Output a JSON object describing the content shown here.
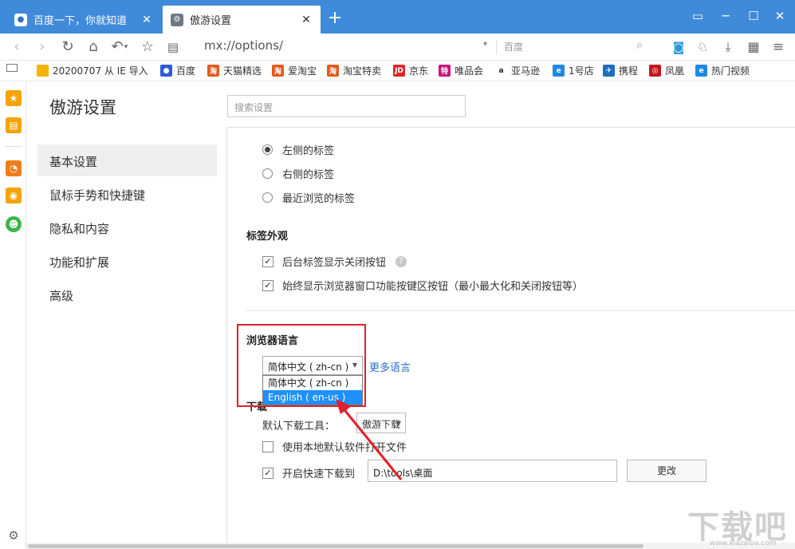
{
  "tabs": [
    {
      "label": "百度一下，你就知道",
      "icon": "baidu-paw-icon"
    },
    {
      "label": "傲游设置",
      "icon": "settings-gear-icon"
    }
  ],
  "address": {
    "url": "mx://options/",
    "search_placeholder": "百度"
  },
  "bookmarks": [
    {
      "label": "20200707 从 IE 导入",
      "icon": "folder-icon",
      "color": "#f2b400"
    },
    {
      "label": "百度",
      "icon": "baidu-icon",
      "color": "#2f5bd9"
    },
    {
      "label": "天猫精选",
      "icon": "tmall-icon",
      "color": "#e35a1c"
    },
    {
      "label": "爱淘宝",
      "icon": "taobao-icon",
      "color": "#e35a1c"
    },
    {
      "label": "淘宝特卖",
      "icon": "taobao-icon",
      "color": "#e35a1c"
    },
    {
      "label": "京东",
      "icon": "jd-icon",
      "color": "#d8262c"
    },
    {
      "label": "唯品会",
      "icon": "vip-icon",
      "color": "#c6167a"
    },
    {
      "label": "亚马逊",
      "icon": "amazon-icon",
      "color": "#222222"
    },
    {
      "label": "1号店",
      "icon": "ie-icon",
      "color": "#1e88e5"
    },
    {
      "label": "携程",
      "icon": "ctrip-icon",
      "color": "#1c6fc0"
    },
    {
      "label": "凤凰",
      "icon": "ifeng-icon",
      "color": "#c4161c"
    },
    {
      "label": "热门视频",
      "icon": "ie-icon",
      "color": "#1e88e5"
    }
  ],
  "page": {
    "title": "傲游设置",
    "search_placeholder": "搜索设置"
  },
  "menu": [
    {
      "label": "基本设置",
      "selected": true
    },
    {
      "label": "鼠标手势和快捷键"
    },
    {
      "label": "隐私和内容"
    },
    {
      "label": "功能和扩展"
    },
    {
      "label": "高级"
    }
  ],
  "tab_close_options": [
    {
      "label": "左侧的标签",
      "checked": true
    },
    {
      "label": "右侧的标签",
      "checked": false
    },
    {
      "label": "最近浏览的标签",
      "checked": false
    }
  ],
  "tab_appearance": {
    "heading": "标签外观",
    "options": [
      {
        "label": "后台标签显示关闭按钮",
        "checked": true
      },
      {
        "label": "始终显示浏览器窗口功能按键区按钮（最小最大化和关闭按钮等）",
        "checked": true
      }
    ]
  },
  "language": {
    "heading": "浏览器语言",
    "selected": "简体中文 ( zh-cn )",
    "options": [
      "简体中文 ( zh-cn )",
      "English ( en-us )"
    ],
    "highlighted": "English ( en-us )",
    "more_link": "更多语言"
  },
  "download": {
    "heading": "下载",
    "tool_label": "默认下载工具：",
    "tool_value": "傲游下载",
    "open_with_default": {
      "label": "使用本地默认软件打开文件",
      "checked": false
    },
    "fast_download": {
      "label": "开启快速下载到",
      "checked": true
    },
    "path": "D:\\tools\\桌面",
    "change_button": "更改"
  },
  "colors": {
    "tabbar": "#3f8ad9",
    "highlight": "#e0202a",
    "link": "#2a6fc9",
    "option_highlight": "#1e90ff"
  }
}
